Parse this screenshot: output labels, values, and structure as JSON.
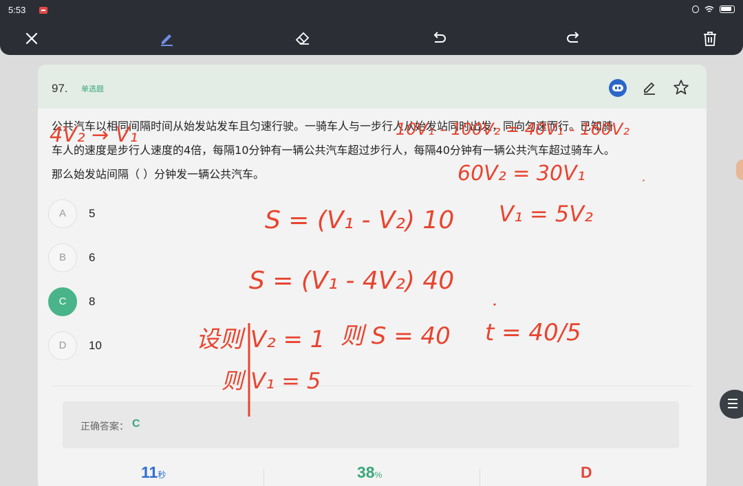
{
  "status": {
    "time": "5:53"
  },
  "question": {
    "number": "97.",
    "type": "单选题",
    "stem": [
      "公共汽车以相同间隔时间从始发站发车且匀速行驶。一骑车人与一步行人从始发站同时出发，同向匀速而行。已知骑",
      "车人的速度是步行人速度的4倍，每隔10分钟有一辆公共汽车超过步行人，每隔40分钟有一辆公共汽车超过骑车人。",
      "那么始发站间隔（    ）分钟发一辆公共汽车。"
    ],
    "options": [
      {
        "letter": "A",
        "value": "5"
      },
      {
        "letter": "B",
        "value": "6"
      },
      {
        "letter": "C",
        "value": "8",
        "selected": true
      },
      {
        "letter": "D",
        "value": "10"
      }
    ]
  },
  "answer": {
    "label": "正确答案：",
    "value": "C"
  },
  "stats": {
    "time": {
      "value": "11",
      "unit": "秒"
    },
    "accuracy": {
      "value": "38",
      "unit": "%"
    },
    "common_wrong": {
      "value": "D"
    }
  },
  "handwriting": {
    "lines": [
      "4V₂ → V₁",
      "10V₁ - 100V₂ = 40V₁ - 160V₂",
      "60V₂ = 30V₁",
      "S = (V₁ - V₂) 10",
      "V₁ = 5V₂",
      "S = (V₁ - 4V₂) 40",
      "设则 V₂ = 1",
      "则 S = 40",
      "t = 40/5",
      "则 V₁ = 5"
    ]
  },
  "colors": {
    "accent": "#49b48a",
    "ink": "#e8442f",
    "time": "#2e6fcf",
    "accuracy": "#3aa67a",
    "wrong": "#e04a3c"
  }
}
